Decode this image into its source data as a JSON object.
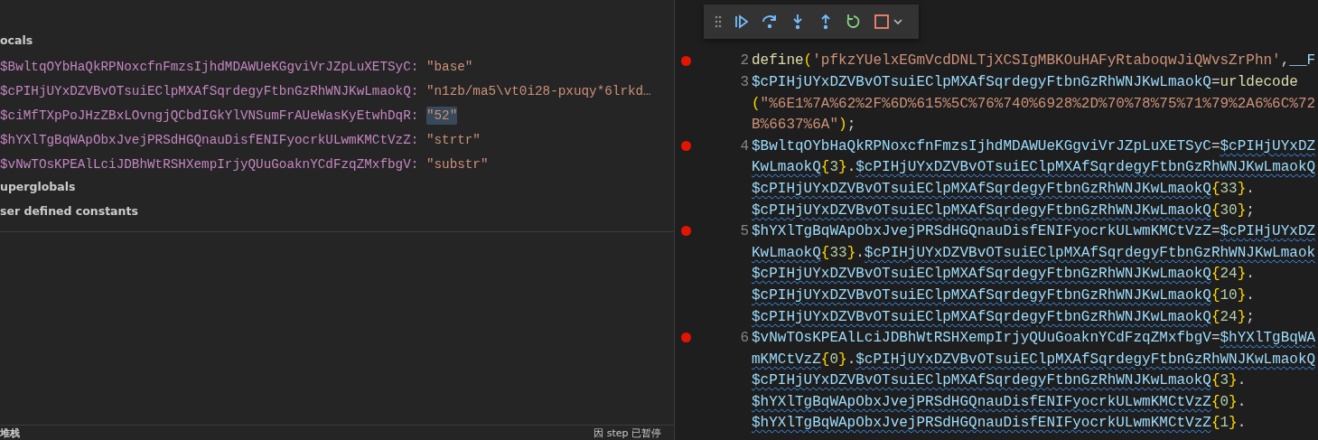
{
  "variables_panel": {
    "scopes": [
      {
        "label": "ocals",
        "variables": [
          {
            "name": "$BwltqOYbHaQkRPNoxcfnFmzsIjhdMDAWUeKGgviVrJZpLuXETSyC:",
            "value": "\"base\"",
            "selected": false
          },
          {
            "name": "$cPIHjUYxDZVBvOTsuiEClpMXAfSqrdegyFtbnGzRhWNJKwLmaokQ:",
            "value": "\"n1zb/ma5\\vt0i28-pxuqy*6lrkd…",
            "selected": false
          },
          {
            "name": "$ciMfTXpPoJHzZBxLOvngjQCbdIGkYlVNSumFrAUeWasKyEtwhDqR:",
            "value": "\"52\"",
            "selected": true
          },
          {
            "name": "$hYXlTgBqWApObxJvejPRSdHGQnauDisfENIFyocrkULwmKMCtVzZ:",
            "value": "\"strtr\"",
            "selected": false
          },
          {
            "name": "$vNwTOsKPEAlLciJDBhWtRSHXempIrjyQUuGoaknYCdFzqZMxfbgV:",
            "value": "\"substr\"",
            "selected": false
          }
        ]
      },
      {
        "label": "uperglobals"
      },
      {
        "label": "ser defined constants"
      }
    ]
  },
  "call_stack_panel": {
    "title": "堆栈",
    "status": "因 step 已暂停"
  },
  "editor": {
    "lines": [
      {
        "number": "2",
        "breakpoint": true,
        "rows": [
          {
            "tokens": [
              {
                "text": "define",
                "kind": "func"
              },
              {
                "text": "(",
                "kind": "brace"
              },
              {
                "text": "'pfkzYUelxEGmVcdDNLTjXCSIgMBKOuHAFyRtaboqwJiQWvsZrPhn'",
                "kind": "str"
              },
              {
                "text": ",",
                "kind": "punct"
              },
              {
                "text": "__F",
                "kind": "var"
              }
            ]
          }
        ]
      },
      {
        "number": "3",
        "breakpoint": false,
        "rows": [
          {
            "tokens": [
              {
                "text": "$cPIHjUYxDZVBvOTsuiEClpMXAfSqrdegyFtbnGzRhWNJKwLmaokQ",
                "kind": "var"
              },
              {
                "text": "=",
                "kind": "punct"
              },
              {
                "text": "urldecode",
                "kind": "func"
              }
            ]
          },
          {
            "tokens": [
              {
                "text": "(",
                "kind": "brace"
              },
              {
                "text": "\"%6E1%7A%62%2F%6D%615%5C%76%740%6928%2D%70%78%75%71%79%2A6%6C%72",
                "kind": "str"
              }
            ]
          },
          {
            "tokens": [
              {
                "text": "B%6637%6A\"",
                "kind": "str"
              },
              {
                "text": ")",
                "kind": "brace"
              },
              {
                "text": ";",
                "kind": "punct"
              }
            ]
          }
        ]
      },
      {
        "number": "4",
        "breakpoint": true,
        "rows": [
          {
            "tokens": [
              {
                "text": "$BwltqOYbHaQkRPNoxcfnFmzsIjhdMDAWUeKGgviVrJZpLuXETSyC",
                "kind": "var"
              },
              {
                "text": "=",
                "kind": "punct"
              },
              {
                "text": "$cPIHjUYxDZ",
                "kind": "var",
                "squiggle": true
              }
            ]
          },
          {
            "tokens": [
              {
                "text": "KwLmaokQ",
                "kind": "var",
                "squiggle": true
              },
              {
                "text": "{",
                "kind": "brace"
              },
              {
                "text": "3",
                "kind": "num"
              },
              {
                "text": "}",
                "kind": "brace"
              },
              {
                "text": ".",
                "kind": "punct"
              },
              {
                "text": "$cPIHjUYxDZVBvOTsuiEClpMXAfSqrdegyFtbnGzRhWNJKwLmaokQ",
                "kind": "var",
                "squiggle": true
              }
            ]
          },
          {
            "tokens": [
              {
                "text": "$cPIHjUYxDZVBvOTsuiEClpMXAfSqrdegyFtbnGzRhWNJKwLmaokQ",
                "kind": "var",
                "squiggle": true
              },
              {
                "text": "{",
                "kind": "brace"
              },
              {
                "text": "33",
                "kind": "num"
              },
              {
                "text": "}",
                "kind": "brace"
              },
              {
                "text": ".",
                "kind": "punct"
              }
            ]
          },
          {
            "tokens": [
              {
                "text": "$cPIHjUYxDZVBvOTsuiEClpMXAfSqrdegyFtbnGzRhWNJKwLmaokQ",
                "kind": "var",
                "squiggle": true
              },
              {
                "text": "{",
                "kind": "brace"
              },
              {
                "text": "30",
                "kind": "num"
              },
              {
                "text": "}",
                "kind": "brace"
              },
              {
                "text": ";",
                "kind": "punct"
              }
            ]
          }
        ]
      },
      {
        "number": "5",
        "breakpoint": true,
        "rows": [
          {
            "tokens": [
              {
                "text": "$hYXlTgBqWApObxJvejPRSdHGQnauDisfENIFyocrkULwmKMCtVzZ",
                "kind": "var"
              },
              {
                "text": "=",
                "kind": "punct"
              },
              {
                "text": "$cPIHjUYxDZ",
                "kind": "var",
                "squiggle": true
              }
            ]
          },
          {
            "tokens": [
              {
                "text": "KwLmaokQ",
                "kind": "var",
                "squiggle": true
              },
              {
                "text": "{",
                "kind": "brace"
              },
              {
                "text": "33",
                "kind": "num"
              },
              {
                "text": "}",
                "kind": "brace"
              },
              {
                "text": ".",
                "kind": "punct"
              },
              {
                "text": "$cPIHjUYxDZVBvOTsuiEClpMXAfSqrdegyFtbnGzRhWNJKwLmaok",
                "kind": "var",
                "squiggle": true
              }
            ]
          },
          {
            "tokens": [
              {
                "text": "$cPIHjUYxDZVBvOTsuiEClpMXAfSqrdegyFtbnGzRhWNJKwLmaokQ",
                "kind": "var",
                "squiggle": true
              },
              {
                "text": "{",
                "kind": "brace"
              },
              {
                "text": "24",
                "kind": "num"
              },
              {
                "text": "}",
                "kind": "brace"
              },
              {
                "text": ".",
                "kind": "punct"
              }
            ]
          },
          {
            "tokens": [
              {
                "text": "$cPIHjUYxDZVBvOTsuiEClpMXAfSqrdegyFtbnGzRhWNJKwLmaokQ",
                "kind": "var",
                "squiggle": true
              },
              {
                "text": "{",
                "kind": "brace"
              },
              {
                "text": "10",
                "kind": "num"
              },
              {
                "text": "}",
                "kind": "brace"
              },
              {
                "text": ".",
                "kind": "punct"
              }
            ]
          },
          {
            "tokens": [
              {
                "text": "$cPIHjUYxDZVBvOTsuiEClpMXAfSqrdegyFtbnGzRhWNJKwLmaokQ",
                "kind": "var",
                "squiggle": true
              },
              {
                "text": "{",
                "kind": "brace"
              },
              {
                "text": "24",
                "kind": "num"
              },
              {
                "text": "}",
                "kind": "brace"
              },
              {
                "text": ";",
                "kind": "punct"
              }
            ]
          }
        ]
      },
      {
        "number": "6",
        "breakpoint": true,
        "rows": [
          {
            "tokens": [
              {
                "text": "$vNwTOsKPEAlLciJDBhWtRSHXempIrjyQUuGoaknYCdFzqZMxfbgV",
                "kind": "var"
              },
              {
                "text": "=",
                "kind": "punct"
              },
              {
                "text": "$hYXlTgBqWA",
                "kind": "var",
                "squiggle": true
              }
            ]
          },
          {
            "tokens": [
              {
                "text": "mKMCtVzZ",
                "kind": "var",
                "squiggle": true
              },
              {
                "text": "{",
                "kind": "brace"
              },
              {
                "text": "0",
                "kind": "num"
              },
              {
                "text": "}",
                "kind": "brace"
              },
              {
                "text": ".",
                "kind": "punct"
              },
              {
                "text": "$cPIHjUYxDZVBvOTsuiEClpMXAfSqrdegyFtbnGzRhWNJKwLmaokQ",
                "kind": "var",
                "squiggle": true
              }
            ]
          },
          {
            "tokens": [
              {
                "text": "$cPIHjUYxDZVBvOTsuiEClpMXAfSqrdegyFtbnGzRhWNJKwLmaokQ",
                "kind": "var",
                "squiggle": true
              },
              {
                "text": "{",
                "kind": "brace"
              },
              {
                "text": "3",
                "kind": "num"
              },
              {
                "text": "}",
                "kind": "brace"
              },
              {
                "text": ".",
                "kind": "punct"
              }
            ]
          },
          {
            "tokens": [
              {
                "text": "$hYXlTgBqWApObxJvejPRSdHGQnauDisfENIFyocrkULwmKMCtVzZ",
                "kind": "var",
                "squiggle": true
              },
              {
                "text": "{",
                "kind": "brace"
              },
              {
                "text": "0",
                "kind": "num"
              },
              {
                "text": "}",
                "kind": "brace"
              },
              {
                "text": ".",
                "kind": "punct"
              }
            ]
          },
          {
            "tokens": [
              {
                "text": "$hYXlTgBqWApObxJvejPRSdHGQnauDisfENIFyocrkULwmKMCtVzZ",
                "kind": "var",
                "squiggle": true
              },
              {
                "text": "{",
                "kind": "brace"
              },
              {
                "text": "1",
                "kind": "num"
              },
              {
                "text": "}",
                "kind": "brace"
              },
              {
                "text": ".",
                "kind": "punct"
              }
            ]
          }
        ]
      }
    ]
  }
}
